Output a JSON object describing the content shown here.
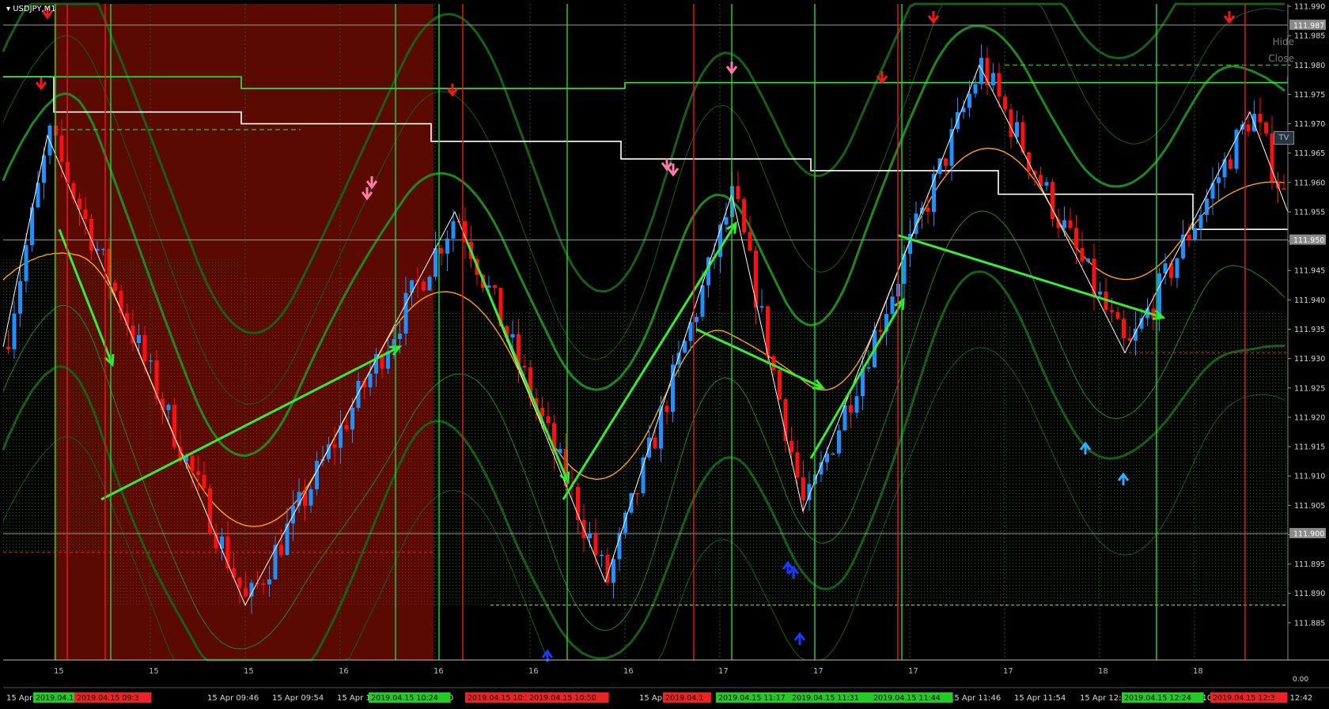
{
  "window": {
    "symbol_label": "USDJPY,M1"
  },
  "controls": {
    "hide": "Hide",
    "close": "Close",
    "tv": "TV"
  },
  "price_axis": {
    "min": 111.88,
    "max": 111.99,
    "ticks": [
      "111.990",
      "111.985",
      "111.980",
      "111.975",
      "111.970",
      "111.965",
      "111.960",
      "111.955",
      "111.950",
      "111.945",
      "111.940",
      "111.935",
      "111.930",
      "111.925",
      "111.920",
      "111.915",
      "111.910",
      "111.905",
      "111.900",
      "111.895",
      "111.890",
      "111.885"
    ],
    "highlight_labels": [
      {
        "text": "111.987",
        "price": 111.9868
      },
      {
        "text": "111.950",
        "price": 111.9502
      },
      {
        "text": "111.900",
        "price": 111.9002
      }
    ],
    "bottom_label": "0.00"
  },
  "upper_scale_labels": [
    "15",
    "15",
    "15",
    "16",
    "16",
    "16",
    "16",
    "17",
    "17",
    "17",
    "17",
    "18",
    "18",
    "18",
    "18"
  ],
  "time_axis": {
    "labels": [
      "15 Apr 2",
      "15 Apr 09:46",
      "15 Apr 09:54",
      "15 Apr 10:02",
      "15 Apr 10:10",
      "15 Apr",
      "15 Apr",
      "15 Apr 10:58",
      "15 Apr",
      "15 Apr",
      "15 Apr 11:46",
      "15 Apr 11:54",
      "15 Apr 12:02",
      "15 Apr 12:10",
      "15 Apr 12:26",
      "Apr 12:42"
    ],
    "badges": [
      {
        "text": "2019.04.15",
        "color": "#22cc22"
      },
      {
        "text": "2019.04.15 09:3",
        "color": "#ee2222"
      },
      {
        "text": "2019.04.15 10:24",
        "color": "#22cc22"
      },
      {
        "text": "2019.04.15 10:3",
        "color": "#ee2222"
      },
      {
        "text": "2019.04.15 10:50",
        "color": "#ee2222"
      },
      {
        "text": "2019.04.1",
        "color": "#ee2222"
      },
      {
        "text": "2019.04.15 11:17",
        "color": "#22cc22"
      },
      {
        "text": "2019.04.15 11:31",
        "color": "#22cc22"
      },
      {
        "text": "2019.04.15 11:44",
        "color": "#22cc22"
      },
      {
        "text": "2019.04.15 12:24",
        "color": "#22cc22"
      },
      {
        "text": "2019.04.15 12:3",
        "color": "#ee2222"
      }
    ]
  },
  "colors": {
    "background": "#000000",
    "bull_candle": "#1e90ff",
    "bear_candle": "#ff1010",
    "ma": "#ffa500",
    "envelope": "#1a7a1a",
    "arrow": "#33ee33",
    "zigzag": "#ffffff",
    "red_zone": "#5a0a00"
  },
  "chart_data": {
    "type": "candlestick",
    "symbol": "USDJPY",
    "timeframe": "M1",
    "ylim": [
      111.88,
      111.99
    ],
    "time_labels": [
      "09:46",
      "09:54",
      "10:02",
      "10:10",
      "10:58",
      "11:46",
      "11:54",
      "12:02",
      "12:10",
      "12:26",
      "12:42"
    ],
    "zigzag": [
      111.932,
      111.968,
      111.888,
      111.955,
      111.892,
      111.958,
      111.904,
      111.98,
      111.931,
      111.972,
      111.955
    ],
    "support_levels": [
      111.9002,
      111.95,
      111.9868
    ],
    "visible_swing_prices": {
      "high": 111.98,
      "low": 111.888
    }
  }
}
